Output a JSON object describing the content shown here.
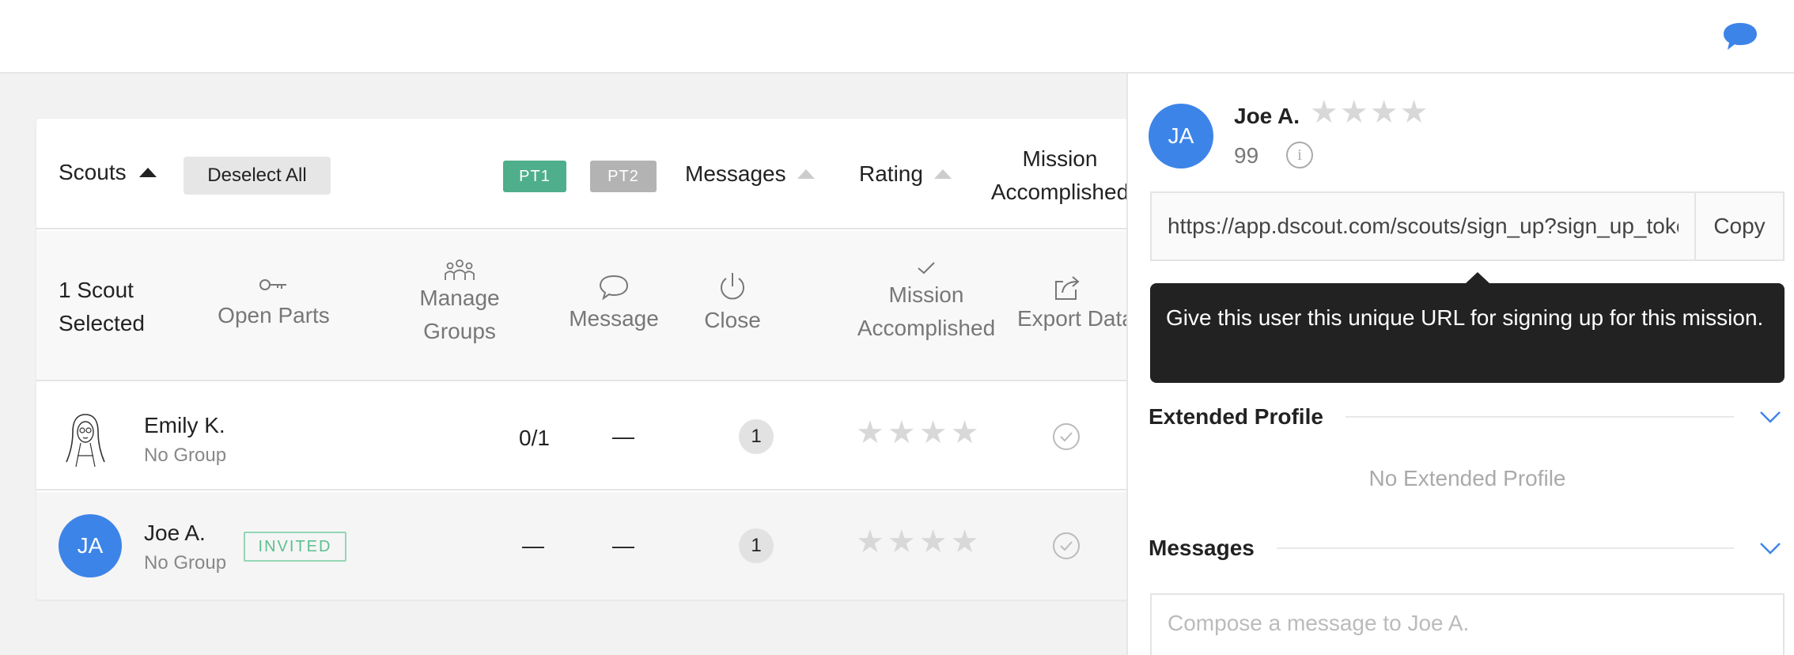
{
  "colors": {
    "accent": "#3d84e8",
    "pt1": "#4fae8c",
    "pt2": "#b3b3b3",
    "invited": "#5cbf8e",
    "tooltip_bg": "#222222"
  },
  "table": {
    "header": {
      "scouts_label": "Scouts",
      "deselect_label": "Deselect All",
      "pt1_label": "PT1",
      "pt2_label": "PT2",
      "messages_label": "Messages",
      "rating_label": "Rating",
      "mission_label_line1": "Mission",
      "mission_label_line2": "Accomplished"
    },
    "actions": {
      "selected_line1": "1 Scout",
      "selected_line2": "Selected",
      "open_parts": "Open Parts",
      "manage_groups_line1": "Manage",
      "manage_groups_line2": "Groups",
      "message": "Message",
      "close": "Close",
      "mission_line1": "Mission",
      "mission_line2": "Accomplished",
      "export": "Export Data"
    },
    "rows": [
      {
        "name": "Emily K.",
        "group": "No Group",
        "pt1": "0/1",
        "pt2": "—",
        "messages": "1",
        "stars": "★★★★",
        "rating": 0
      },
      {
        "initials": "JA",
        "name": "Joe A.",
        "group": "No Group",
        "status": "INVITED",
        "pt1": "—",
        "pt2": "—",
        "messages": "1",
        "stars": "★★★★",
        "rating": 0
      }
    ]
  },
  "panel": {
    "initials": "JA",
    "name": "Joe A.",
    "stars": "★★★★",
    "rating": 0,
    "score": "99",
    "info_symbol": "i",
    "signup_url": "https://app.dscout.com/scouts/sign_up?sign_up_token",
    "copy_label": "Copy",
    "tooltip": "Give this user this unique URL for signing up for this mission.",
    "extended_profile_title": "Extended Profile",
    "no_extended_profile": "No Extended Profile",
    "messages_title": "Messages",
    "compose_placeholder": "Compose a message to Joe A."
  }
}
